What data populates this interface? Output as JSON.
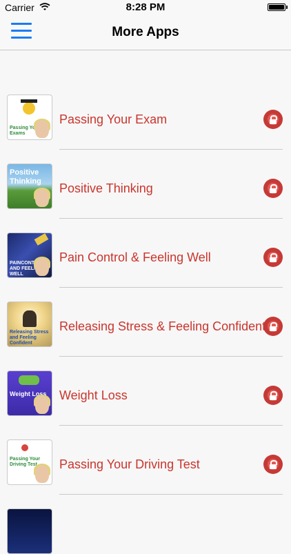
{
  "status_bar": {
    "carrier": "Carrier",
    "time": "8:28 PM"
  },
  "nav": {
    "title": "More Apps",
    "menu_icon": "hamburger-icon"
  },
  "items": [
    {
      "label": "Passing Your Exam",
      "thumb_text": "Passing Your Exams"
    },
    {
      "label": "Positive Thinking",
      "thumb_text": "Positive Thinking"
    },
    {
      "label": "Pain Control & Feeling Well",
      "thumb_text": "PAINCONTROL AND FEELING WELL"
    },
    {
      "label": "Releasing Stress & Feeling Confident",
      "thumb_text": "Releasing Stress and Feeling Confident"
    },
    {
      "label": "Weight Loss",
      "thumb_text": "Weight Loss"
    },
    {
      "label": "Passing Your Driving Test",
      "thumb_text": "Passing Your Driving Test"
    }
  ],
  "colors": {
    "accent": "#1a7cf3",
    "label": "#c9352d",
    "lock": "#c53a36"
  }
}
